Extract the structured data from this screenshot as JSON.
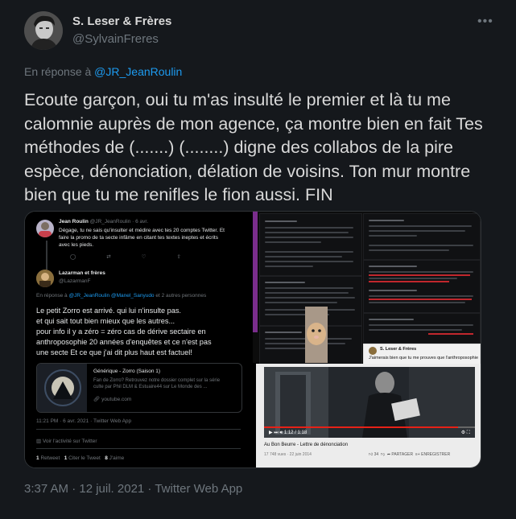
{
  "author": {
    "name": "S. Leser & Frères",
    "handle": "@SylvainFreres"
  },
  "more_label": "•••",
  "reply": {
    "prefix": "En réponse à ",
    "mention": "@JR_JeanRoulin"
  },
  "tweet_text": "Ecoute garçon, oui tu m'as insulté le premier et là tu me calomnie auprès de mon agence, ça montre bien en fait Tes méthodes de (.......) (........) digne des collabos de la pire espèce, dénonciation, délation de voisins. Ton mur montre bien que tu me renifles le fion aussi. FIN",
  "timestamp": "3:37 AM · 12 juil. 2021 · Twitter Web App",
  "media": {
    "left_panel": {
      "tweet1_name": "Jean Roulin",
      "tweet1_meta": "@JR_JeanRoulin · 6 avr.",
      "tweet1_text_1": "Dégage, tu ne sais qu'insulter et médire avec tes 20 comptes Twitter. Et",
      "tweet1_text_2": "faire la promo de ta secte infâme en citant tes textes ineptes et écrits",
      "tweet1_text_3": "avec les pieds.",
      "tweet2_name": "Lazarman et frères",
      "tweet2_handle": "@LazarmanF",
      "reply_prefix": "En réponse à ",
      "reply_mentions": "@JR_JeanRoulin @Manel_Sanyudo",
      "reply_suffix": " et 2 autres personnes",
      "body_1": "Le petit Zorro est arrivé. qui lui n'insulte pas.",
      "body_2": "et qui sait tout bien mieux que les autres...",
      "body_3": "pour info il y a zéro = zéro cas de dérive sectaire en",
      "body_4": "anthroposophie 20 années d'enquêtes et ce n'est pas",
      "body_5": "une secte Et ce que j'ai dit plus haut est factuel!",
      "card_title": "Générique - Zorro (Saison 1)",
      "card_desc_1": "Fan de Zorro? Retrouvez notre dossier complet sur la série",
      "card_desc_2": "culte par Phil DLM & Estuaire44 sur Le Monde des ...",
      "card_link": "youtube.com",
      "time_line": "11:21 PM · 6 avr. 2021 · Twitter Web App",
      "activity": "Voir l'activité sur Twitter",
      "retweets": "1",
      "retweet_label": "Retweet",
      "quotes": "1",
      "quote_label": "Citer le Tweet",
      "likes": "8",
      "likes_label": "J'aime"
    },
    "right_panel": {
      "video_title": "Au Bon Beurre - Lettre de dénonciation",
      "video_meta": "17 748 vues · 22 juin 2014",
      "video_time": "1:12 / 1:18",
      "likes": "34",
      "share": "PARTAGER",
      "save": "ENREGISTRER",
      "red_caption": "J'aimerais bien que tu me prouves que l'anthroposophie",
      "lazarman_name": "S. Leser & Frères"
    }
  },
  "colors": {
    "background": "#15181c",
    "text": "#d9d9d9",
    "muted": "#6e767d",
    "link": "#1d9bf0"
  }
}
